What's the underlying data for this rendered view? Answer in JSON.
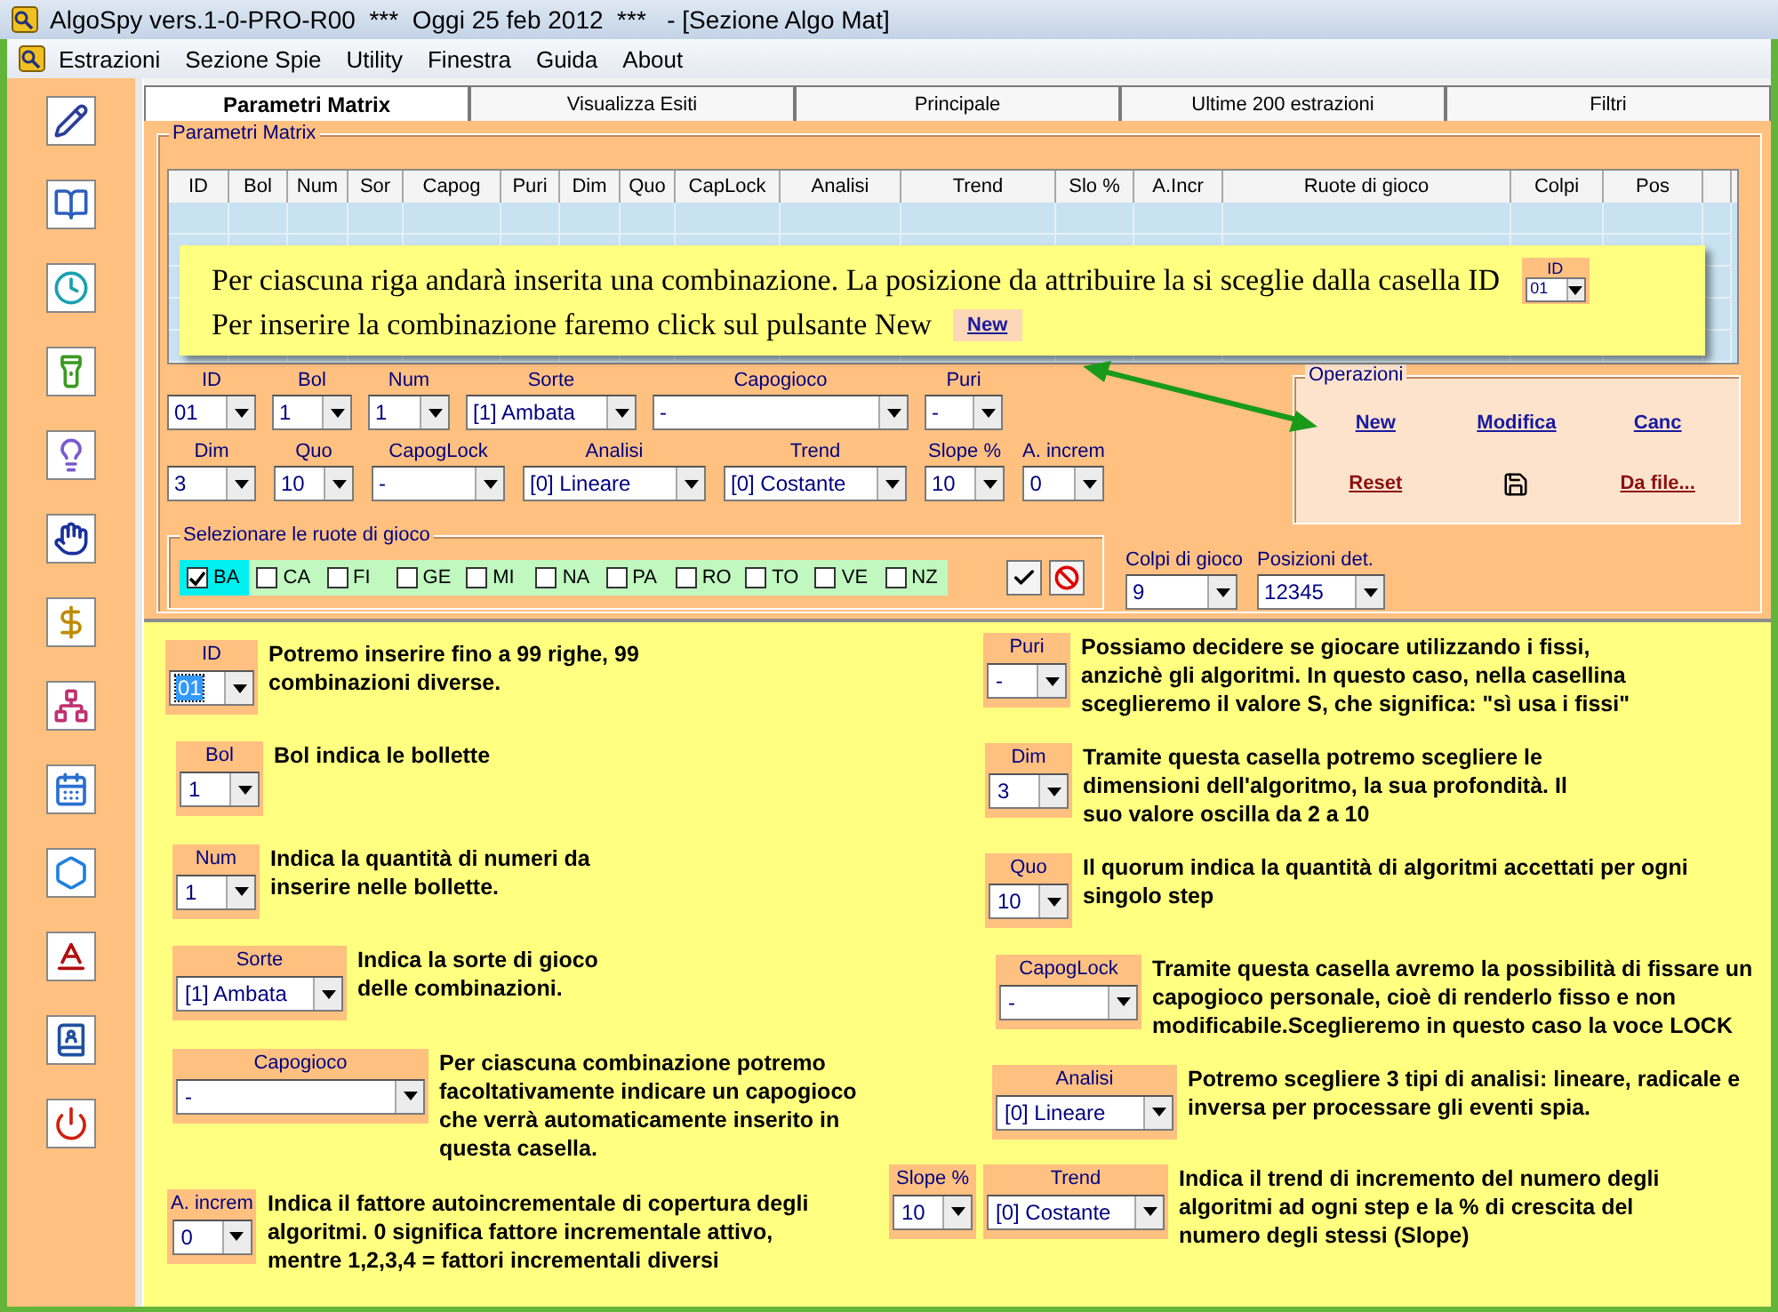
{
  "window": {
    "title": "AlgoSpy vers.1-0-PRO-R00  ***  Oggi 25 feb 2012  ***   - [Sezione Algo Mat]"
  },
  "menu": [
    "Estrazioni",
    "Sezione Spie",
    "Utility",
    "Finestra",
    "Guida",
    "About"
  ],
  "tabs": [
    {
      "label": "Parametri Matrix",
      "selected": true
    },
    {
      "label": "Visualizza Esiti",
      "selected": false
    },
    {
      "label": "Principale",
      "selected": false
    },
    {
      "label": "Ultime 200 estrazioni",
      "selected": false
    },
    {
      "label": "Filtri",
      "selected": false
    }
  ],
  "matrix": {
    "title": "Parametri Matrix",
    "columns": [
      "ID",
      "Bol",
      "Num",
      "Sor",
      "Capog",
      "Puri",
      "Dim",
      "Quo",
      "CapLock",
      "Analisi",
      "Trend",
      "Slo %",
      "A.Incr",
      "Ruote di gioco",
      "Colpi",
      "Pos"
    ]
  },
  "callout": {
    "lines": [
      "Per ciascuna riga andarà inserita una combinazione. La posizione da attribuire la si sceglie dalla casella ID",
      "Per inserire la combinazione faremo click sul pulsante New"
    ],
    "button": "New",
    "field": {
      "label": "ID",
      "value": "01"
    }
  },
  "fields": [
    [
      {
        "label": "ID",
        "value": "01"
      },
      {
        "label": "Bol",
        "value": "1"
      },
      {
        "label": "Num",
        "value": "1"
      },
      {
        "label": "Sorte",
        "value": "[1] Ambata"
      },
      {
        "label": "Capogioco",
        "value": "-"
      },
      {
        "label": "Puri",
        "value": "-"
      }
    ],
    [
      {
        "label": "Dim",
        "value": "3"
      },
      {
        "label": "Quo",
        "value": "10"
      },
      {
        "label": "CapogLock",
        "value": "-"
      },
      {
        "label": "Analisi",
        "value": "[0] Lineare"
      },
      {
        "label": "Trend",
        "value": "[0] Costante"
      },
      {
        "label": "Slope %",
        "value": "10"
      },
      {
        "label": "A. increm",
        "value": "0"
      }
    ]
  ],
  "operations": {
    "title": "Operazioni",
    "actions": [
      {
        "kind": "link",
        "label": "New"
      },
      {
        "kind": "link",
        "label": "Modifica"
      },
      {
        "kind": "link",
        "label": "Canc"
      },
      {
        "kind": "danger",
        "label": "Reset"
      },
      {
        "kind": "save"
      },
      {
        "kind": "danger",
        "label": "Da file..."
      }
    ]
  },
  "wheels": {
    "title": "Selezionare le ruote di gioco",
    "items": [
      {
        "label": "BA",
        "checked": true,
        "selected": true
      },
      {
        "label": "CA",
        "checked": false,
        "selected": false
      },
      {
        "label": "FI",
        "checked": false,
        "selected": false
      },
      {
        "label": "GE",
        "checked": false,
        "selected": false
      },
      {
        "label": "MI",
        "checked": false,
        "selected": false
      },
      {
        "label": "NA",
        "checked": false,
        "selected": false
      },
      {
        "label": "PA",
        "checked": false,
        "selected": false
      },
      {
        "label": "RO",
        "checked": false,
        "selected": false
      },
      {
        "label": "TO",
        "checked": false,
        "selected": false
      },
      {
        "label": "VE",
        "checked": false,
        "selected": false
      },
      {
        "label": "NZ",
        "checked": false,
        "selected": false
      }
    ]
  },
  "extra_fields": [
    {
      "label": "Colpi di gioco",
      "value": "9"
    },
    {
      "label": "Posizioni det.",
      "value": "12345"
    }
  ],
  "help_left": [
    {
      "controls": [
        {
          "label": "ID",
          "value": "01",
          "highlighted": true
        }
      ],
      "text": "Potremo inserire fino a 99 righe, 99 combinazioni diverse."
    },
    {
      "controls": [
        {
          "label": "Bol",
          "value": "1",
          "highlighted": false
        }
      ],
      "text": "Bol indica le bollette"
    },
    {
      "controls": [
        {
          "label": "Num",
          "value": "1",
          "highlighted": false
        }
      ],
      "text": "Indica la quantità di numeri da inserire nelle bollette."
    },
    {
      "controls": [
        {
          "label": "Sorte",
          "value": "[1] Ambata",
          "highlighted": false
        }
      ],
      "text": "Indica la sorte di gioco delle combinazioni."
    },
    {
      "controls": [
        {
          "label": "Capogioco",
          "value": "-",
          "highlighted": false
        }
      ],
      "text": "Per ciascuna combinazione potremo facoltativamente indicare un capogioco che verrà automaticamente inserito in questa casella."
    },
    {
      "controls": [
        {
          "label": "A. increm",
          "value": "0",
          "highlighted": false
        }
      ],
      "text": "Indica il fattore autoincrementale di copertura degli algoritmi. 0 significa fattore incrementale attivo, mentre 1,2,3,4 = fattori incrementali diversi"
    }
  ],
  "help_right": [
    {
      "controls": [
        {
          "label": "Puri",
          "value": "-",
          "highlighted": false
        }
      ],
      "text": "Possiamo decidere se giocare utilizzando i fissi, anzichè gli algoritmi. In questo caso, nella casellina sceglieremo il valore S, che significa: \"sì usa i fissi\""
    },
    {
      "controls": [
        {
          "label": "Dim",
          "value": "3",
          "highlighted": false
        }
      ],
      "text": "Tramite questa casella potremo scegliere le dimensioni dell'algoritmo, la sua profondità. Il suo valore oscilla da 2 a 10"
    },
    {
      "controls": [
        {
          "label": "Quo",
          "value": "10",
          "highlighted": false
        }
      ],
      "text": "Il quorum indica la quantità di algoritmi accettati per ogni singolo step"
    },
    {
      "controls": [
        {
          "label": "CapogLock",
          "value": "-",
          "highlighted": false
        }
      ],
      "text": "Tramite questa casella avremo la possibilità di fissare un capogioco personale, cioè di renderlo fisso e non modificabile.Sceglieremo in questo caso la voce LOCK"
    },
    {
      "controls": [
        {
          "label": "Analisi",
          "value": "[0] Lineare",
          "highlighted": false
        }
      ],
      "text": "Potremo scegliere 3 tipi di analisi: lineare, radicale e inversa per processare gli eventi spia."
    },
    {
      "controls": [
        {
          "label": "Slope %",
          "value": "10",
          "highlighted": false
        },
        {
          "label": "Trend",
          "value": "[0] Costante",
          "highlighted": false
        }
      ],
      "text": "Indica il trend di incremento del numero degli algoritmi ad ogni step e la % di crescita del numero degli stessi (Slope)"
    }
  ]
}
